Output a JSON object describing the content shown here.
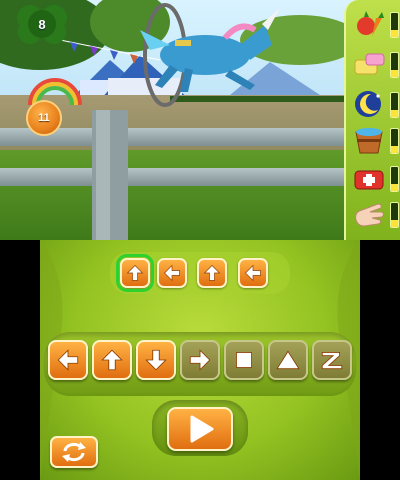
{
  "hud": {
    "lap_counter": "8",
    "jump_counter": "11"
  },
  "items": [
    {
      "icon": "vegetables-icon",
      "meter_fraction": 0.3
    },
    {
      "icon": "sponge-soap-icon",
      "meter_fraction": 0.3
    },
    {
      "icon": "moon-sleep-icon",
      "meter_fraction": 0.3
    },
    {
      "icon": "water-bucket-icon",
      "meter_fraction": 0.3
    },
    {
      "icon": "first-aid-kit-icon",
      "meter_fraction": 0.3
    },
    {
      "icon": "petting-hand-icon",
      "meter_fraction": 0.3
    }
  ],
  "sequence": [
    {
      "icon": "arrow-up-icon",
      "selected": true
    },
    {
      "icon": "arrow-left-icon",
      "selected": false
    },
    {
      "icon": "arrow-up-icon",
      "selected": false
    },
    {
      "icon": "arrow-left-icon",
      "selected": false
    }
  ],
  "commands": [
    {
      "icon": "arrow-left-icon",
      "enabled": true
    },
    {
      "icon": "arrow-up-icon",
      "enabled": true
    },
    {
      "icon": "arrow-down-icon",
      "enabled": true
    },
    {
      "icon": "arrow-right-icon",
      "enabled": false
    },
    {
      "icon": "stop-square-icon",
      "enabled": false
    },
    {
      "icon": "jump-triangle-icon",
      "enabled": false
    },
    {
      "icon": "zigzag-icon",
      "enabled": false
    }
  ],
  "colors": {
    "accent_orange": "#e06e10",
    "panel_green": "#94c322",
    "selected_outline": "#2fd12f",
    "disabled_olive": "#7f7d35"
  }
}
